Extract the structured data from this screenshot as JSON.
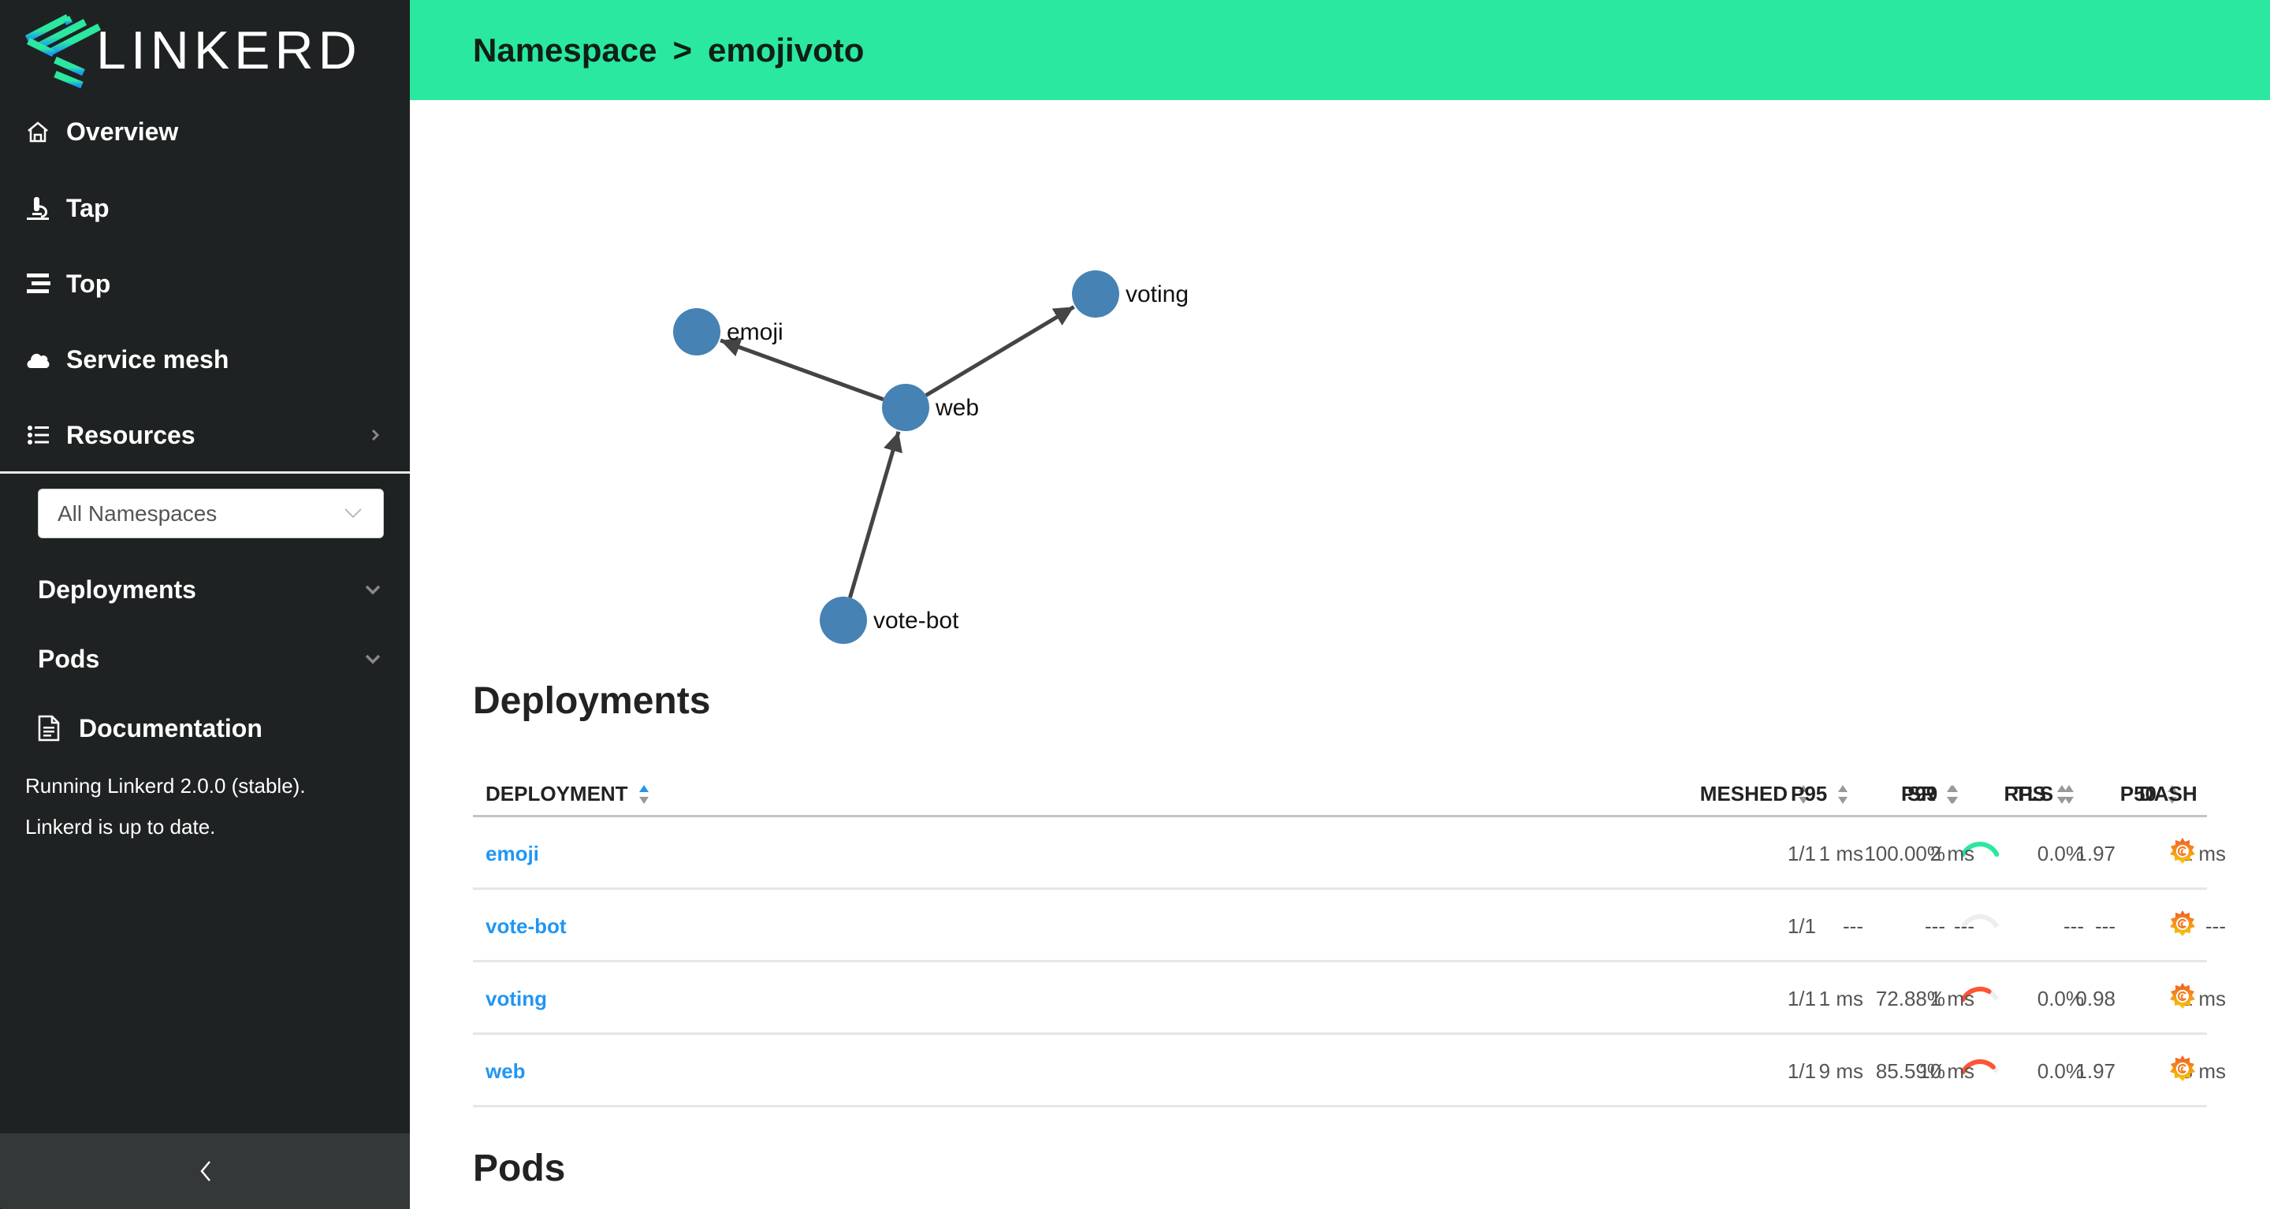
{
  "app": {
    "brand": "LINKERD"
  },
  "sidebar": {
    "nav": [
      {
        "label": "Overview",
        "icon": "home-icon"
      },
      {
        "label": "Tap",
        "icon": "microscope-icon"
      },
      {
        "label": "Top",
        "icon": "stream-icon"
      },
      {
        "label": "Service mesh",
        "icon": "cloud-icon"
      },
      {
        "label": "Resources",
        "icon": "list-icon"
      }
    ],
    "namespace_select": {
      "value": "All Namespaces"
    },
    "sub": [
      {
        "label": "Deployments"
      },
      {
        "label": "Pods"
      }
    ],
    "documentation": {
      "label": "Documentation"
    },
    "status": [
      "Running Linkerd 2.0.0 (stable).",
      "Linkerd is up to date."
    ],
    "collapse_icon": "chevron-left-icon"
  },
  "header": {
    "crumb_root": "Namespace",
    "separator": ">",
    "crumb_current": "emojivoto"
  },
  "graph": {
    "nodes": [
      {
        "id": "emoji",
        "label": "emoji"
      },
      {
        "id": "voting",
        "label": "voting"
      },
      {
        "id": "web",
        "label": "web"
      },
      {
        "id": "vote-bot",
        "label": "vote-bot"
      }
    ],
    "edges": [
      {
        "from": "web",
        "to": "emoji"
      },
      {
        "from": "web",
        "to": "voting"
      },
      {
        "from": "vote-bot",
        "to": "web"
      }
    ]
  },
  "deployments": {
    "title": "Deployments",
    "columns": [
      "DEPLOYMENT",
      "MESHED",
      "SR",
      "RPS",
      "P50",
      "P95",
      "P99",
      "TLS",
      "DASH"
    ],
    "sorted_by": "DEPLOYMENT",
    "sort_direction": "ascending",
    "rows": [
      {
        "name": "emoji",
        "meshed": "1/1",
        "sr": "100.00%",
        "sr_value": 1.0,
        "sr_status": "good",
        "rps": "1.97",
        "p50": "1 ms",
        "p95": "1 ms",
        "p99": "2 ms",
        "tls": "0.0%"
      },
      {
        "name": "vote-bot",
        "meshed": "1/1",
        "sr": "---",
        "sr_value": null,
        "sr_status": "none",
        "rps": "---",
        "p50": "---",
        "p95": "---",
        "p99": "---",
        "tls": "---"
      },
      {
        "name": "voting",
        "meshed": "1/1",
        "sr": "72.88%",
        "sr_value": 0.7288,
        "sr_status": "bad",
        "rps": "0.98",
        "p50": "1 ms",
        "p95": "1 ms",
        "p99": "1 ms",
        "tls": "0.0%"
      },
      {
        "name": "web",
        "meshed": "1/1",
        "sr": "85.59%",
        "sr_value": 0.8559,
        "sr_status": "bad",
        "rps": "1.97",
        "p50": "3 ms",
        "p95": "9 ms",
        "p99": "10 ms",
        "tls": "0.0%"
      }
    ],
    "dash_icon": "grafana-icon"
  },
  "pods": {
    "title": "Pods"
  },
  "colors": {
    "brand_green": "#2ae8a0",
    "sidebar_bg": "#1f2222",
    "link_blue": "#2196f3",
    "node_blue": "#4682b4",
    "sr_good": "#2ae8a0",
    "sr_bad": "#ff5533",
    "sr_track": "#eeeeee"
  }
}
